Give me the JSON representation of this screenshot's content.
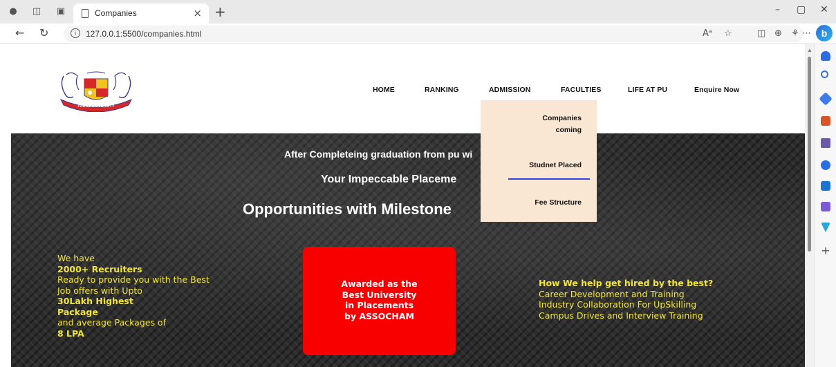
{
  "browser": {
    "tab_title": "Companies",
    "tab_close": "×",
    "new_tab": "+",
    "url": "127.0.0.1:5500/companies.html",
    "window_controls": {
      "minimize": "–",
      "restore": "▢",
      "close": "✕"
    }
  },
  "site": {
    "logo_text": "PARUL UNIVERSITY",
    "nav": [
      {
        "label": "HOME"
      },
      {
        "label": "RANKING"
      },
      {
        "label": "ADMISSION"
      },
      {
        "label": "FACULTIES"
      },
      {
        "label": "LIFE AT PU"
      },
      {
        "label": "Enquire Now"
      }
    ],
    "dropdown": [
      {
        "label": "Companies coming"
      },
      {
        "label": "Studnet Placed"
      },
      {
        "label": "Fee Structure"
      }
    ]
  },
  "hero": {
    "line1": "After Completeing graduation from pu wi",
    "line2": "Your Impeccable Placeme",
    "line3": "Opportunities with Milestone",
    "left": [
      {
        "text": "We have",
        "bold": false
      },
      {
        "text": "2000+ Recruiters",
        "bold": true
      },
      {
        "text": "Ready to provide you with the Best",
        "bold": false
      },
      {
        "text": "Job offers with Upto",
        "bold": false
      },
      {
        "text": "30Lakh Highest",
        "bold": true
      },
      {
        "text": "Package",
        "bold": true
      },
      {
        "text": "and average Packages of",
        "bold": false
      },
      {
        "text": "8 LPA",
        "bold": true
      }
    ],
    "award": [
      "Awarded as the",
      "Best University",
      "in Placements",
      "by ASSOCHAM"
    ],
    "right": [
      {
        "text": "How We help get hired by the best?",
        "bold": true
      },
      {
        "text": "Career Development and Training",
        "bold": false
      },
      {
        "text": "Industry Collaboration For UpSkilling",
        "bold": false
      },
      {
        "text": "Campus Drives and Interview Training",
        "bold": false
      }
    ]
  },
  "colors": {
    "hero_text": "#f3e633",
    "award_bg": "#f80000",
    "dropdown_bg": "#f9e7d3",
    "dropdown_underline": "#3344dd"
  }
}
